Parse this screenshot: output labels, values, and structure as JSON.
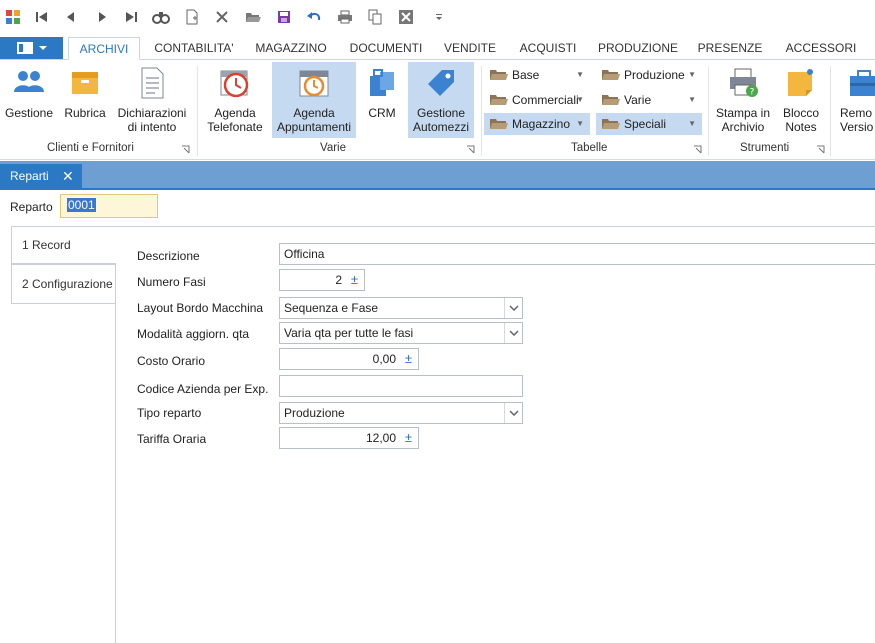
{
  "colors": {
    "accent": "#2b78c5",
    "selected_bg": "#c5daf1",
    "doc_strip": "#6e9fd2",
    "active_input_bg": "#fdf6d9"
  },
  "qat": {
    "icons": [
      "app-logo-icon",
      "first-record-icon",
      "previous-record-icon",
      "next-record-icon",
      "last-record-icon",
      "find-icon",
      "new-document-icon",
      "delete-icon",
      "open-folder-icon",
      "save-icon",
      "undo-icon",
      "print-icon",
      "copy-icon",
      "close-window-icon",
      "customize-dropdown-icon"
    ]
  },
  "tabs": {
    "items": [
      "ARCHIVI",
      "CONTABILITA'",
      "MAGAZZINO",
      "DOCUMENTI",
      "VENDITE",
      "ACQUISTI",
      "PRODUZIONE",
      "PRESENZE",
      "ACCESSORI"
    ],
    "active": "ARCHIVI"
  },
  "ribbon": {
    "clienti": {
      "gestione": "Gestione",
      "rubrica": "Rubrica",
      "dich_1": "Dichiarazioni",
      "dich_2": "di intento",
      "label": "Clienti e Fornitori"
    },
    "varie": {
      "agenda_tel_1": "Agenda",
      "agenda_tel_2": "Telefonate",
      "agenda_app_1": "Agenda",
      "agenda_app_2": "Appuntamenti",
      "crm": "CRM",
      "automezzi_1": "Gestione",
      "automezzi_2": "Automezzi",
      "label": "Varie"
    },
    "tabelle": {
      "base": "Base",
      "commerciali": "Commerciali",
      "magazzino": "Magazzino",
      "produzione": "Produzione",
      "varie": "Varie",
      "speciali": "Speciali",
      "label": "Tabelle"
    },
    "strumenti": {
      "stampa_1": "Stampa in",
      "stampa_2": "Archivio",
      "blocco_1": "Blocco",
      "blocco_2": "Notes",
      "label": "Strumenti"
    },
    "remote": {
      "line_1": "Remo",
      "line_2": "Versio"
    }
  },
  "doc": {
    "tab_label": "Reparti",
    "close": "✕"
  },
  "form": {
    "reparto_label": "Reparto",
    "reparto_value": "0001",
    "side_tabs": [
      "1 Record",
      "2 Configurazione"
    ],
    "fields": {
      "descrizione": {
        "label": "Descrizione",
        "value": "Officina"
      },
      "numero_fasi": {
        "label": "Numero Fasi",
        "value": "2"
      },
      "layout_bordo": {
        "label": "Layout Bordo Macchina",
        "value": "Sequenza e Fase"
      },
      "modalita": {
        "label": "Modalità aggiorn. qta",
        "value": "Varia qta per tutte le fasi"
      },
      "costo_orario": {
        "label": "Costo Orario",
        "value": "0,00"
      },
      "codice_azienda": {
        "label": "Codice Azienda per Exp.",
        "value": ""
      },
      "tipo_reparto": {
        "label": "Tipo reparto",
        "value": "Produzione"
      },
      "tariffa_oraria": {
        "label": "Tariffa Oraria",
        "value": "12,00"
      }
    },
    "spin_glyph": "±"
  }
}
